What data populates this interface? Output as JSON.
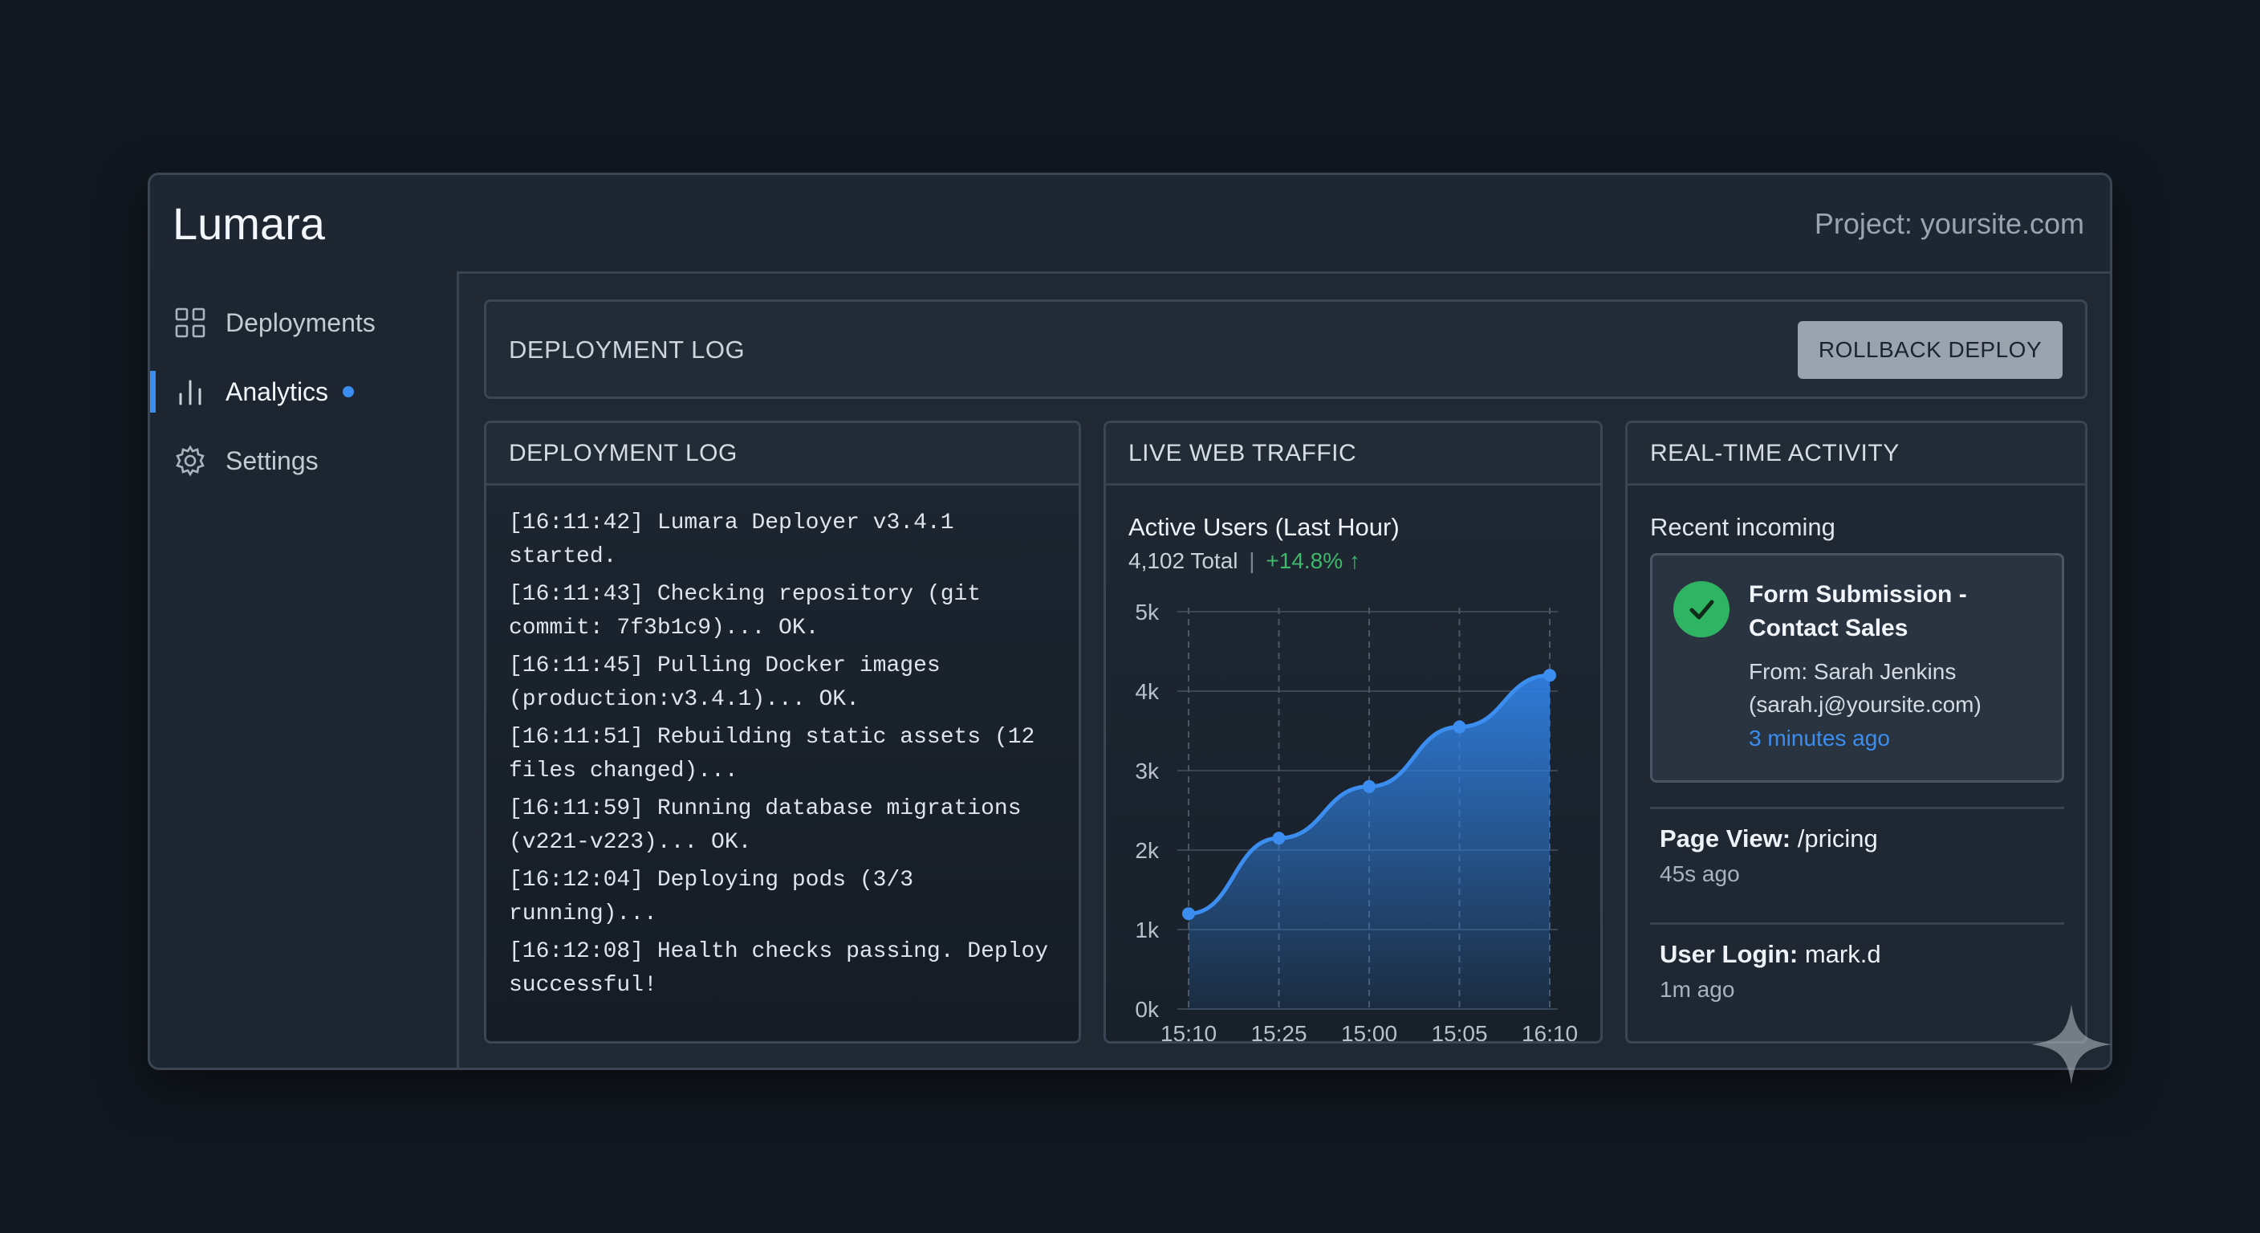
{
  "app": {
    "title": "Lumara",
    "project": "Project: yoursite.com"
  },
  "sidebar": {
    "items": [
      {
        "label": "Deployments",
        "icon": "grid-icon",
        "active": false
      },
      {
        "label": "Analytics",
        "icon": "bar-chart-icon",
        "active": true
      },
      {
        "label": "Settings",
        "icon": "gear-icon",
        "active": false
      }
    ]
  },
  "top_panel": {
    "title": "DEPLOYMENT LOG",
    "button": "ROLLBACK DEPLOY"
  },
  "log_panel": {
    "title": "DEPLOYMENT LOG",
    "lines": [
      "[16:11:42] Lumara Deployer v3.4.1 started.",
      "[16:11:43] Checking repository (git commit: 7f3b1c9)... OK.",
      "[16:11:45] Pulling Docker images (production:v3.4.1)... OK.",
      "[16:11:51] Rebuilding static assets (12 files changed)...",
      "[16:11:59] Running database migrations (v221-v223)... OK.",
      "[16:12:04] Deploying pods (3/3 running)...",
      "[16:12:08] Health checks passing. Deploy successful!"
    ]
  },
  "traffic_panel": {
    "title": "LIVE WEB TRAFFIC",
    "subtitle": "Active Users (Last Hour)",
    "total": "4,102 Total",
    "separator": "|",
    "change": "+14.8% ↑"
  },
  "chart_data": {
    "type": "area",
    "categories": [
      "15:10",
      "15:25",
      "15:00",
      "15:05",
      "16:10"
    ],
    "y_tick_labels": [
      "0k",
      "1k",
      "2k",
      "3k",
      "4k",
      "5k"
    ],
    "series": [
      {
        "values": [
          1200,
          2150,
          2800,
          3550,
          4200
        ]
      }
    ],
    "ylim": [
      0,
      5000
    ],
    "grid": true,
    "colors": {
      "line": "#3b8ef0",
      "fill": "#2f7fe0"
    }
  },
  "activity_panel": {
    "title": "REAL-TIME ACTIVITY",
    "recent_label": "Recent incoming",
    "card": {
      "icon": "check-circle-icon",
      "title": "Form Submission - Contact Sales",
      "from": "From: Sarah Jenkins (sarah.j@yoursite.com)",
      "time": "3 minutes ago"
    },
    "items": [
      {
        "label": "Page View:",
        "value": "/pricing",
        "time": "45s ago"
      },
      {
        "label": "User Login:",
        "value": "mark.d",
        "time": "1m ago"
      }
    ]
  },
  "colors": {
    "accent": "#3b8ef0",
    "success": "#2fb463",
    "background": "#121820"
  }
}
